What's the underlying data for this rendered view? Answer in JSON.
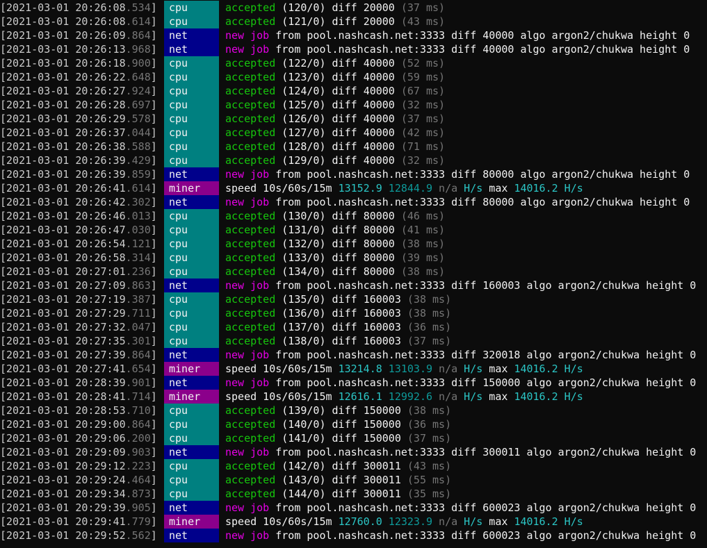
{
  "window": {
    "title": ""
  },
  "lines": [
    {
      "ts": "2021-03-01 20:26:08",
      "ms": ".534",
      "tag": "cpu",
      "kind": "accepted",
      "count": "(120/0)",
      "diff": "20000",
      "lat": "(37 ms)"
    },
    {
      "ts": "2021-03-01 20:26:08",
      "ms": ".614",
      "tag": "cpu",
      "kind": "accepted",
      "count": "(121/0)",
      "diff": "20000",
      "lat": "(43 ms)"
    },
    {
      "ts": "2021-03-01 20:26:09",
      "ms": ".864",
      "tag": "net",
      "kind": "job",
      "pool": "pool.nashcash.net:3333",
      "diff": "40000",
      "algo": "argon2/chukwa",
      "height": "0"
    },
    {
      "ts": "2021-03-01 20:26:13",
      "ms": ".968",
      "tag": "net",
      "kind": "job",
      "pool": "pool.nashcash.net:3333",
      "diff": "40000",
      "algo": "argon2/chukwa",
      "height": "0"
    },
    {
      "ts": "2021-03-01 20:26:18",
      "ms": ".900",
      "tag": "cpu",
      "kind": "accepted",
      "count": "(122/0)",
      "diff": "40000",
      "lat": "(52 ms)"
    },
    {
      "ts": "2021-03-01 20:26:22",
      "ms": ".648",
      "tag": "cpu",
      "kind": "accepted",
      "count": "(123/0)",
      "diff": "40000",
      "lat": "(59 ms)"
    },
    {
      "ts": "2021-03-01 20:26:27",
      "ms": ".924",
      "tag": "cpu",
      "kind": "accepted",
      "count": "(124/0)",
      "diff": "40000",
      "lat": "(67 ms)"
    },
    {
      "ts": "2021-03-01 20:26:28",
      "ms": ".697",
      "tag": "cpu",
      "kind": "accepted",
      "count": "(125/0)",
      "diff": "40000",
      "lat": "(32 ms)"
    },
    {
      "ts": "2021-03-01 20:26:29",
      "ms": ".578",
      "tag": "cpu",
      "kind": "accepted",
      "count": "(126/0)",
      "diff": "40000",
      "lat": "(37 ms)"
    },
    {
      "ts": "2021-03-01 20:26:37",
      "ms": ".044",
      "tag": "cpu",
      "kind": "accepted",
      "count": "(127/0)",
      "diff": "40000",
      "lat": "(42 ms)"
    },
    {
      "ts": "2021-03-01 20:26:38",
      "ms": ".588",
      "tag": "cpu",
      "kind": "accepted",
      "count": "(128/0)",
      "diff": "40000",
      "lat": "(71 ms)"
    },
    {
      "ts": "2021-03-01 20:26:39",
      "ms": ".429",
      "tag": "cpu",
      "kind": "accepted",
      "count": "(129/0)",
      "diff": "40000",
      "lat": "(32 ms)"
    },
    {
      "ts": "2021-03-01 20:26:39",
      "ms": ".859",
      "tag": "net",
      "kind": "job",
      "pool": "pool.nashcash.net:3333",
      "diff": "80000",
      "algo": "argon2/chukwa",
      "height": "0"
    },
    {
      "ts": "2021-03-01 20:26:41",
      "ms": ".614",
      "tag": "miner",
      "kind": "speed",
      "s10": "13152.9",
      "s60": "12844.9",
      "s15": "n/a",
      "max": "14016.2"
    },
    {
      "ts": "2021-03-01 20:26:42",
      "ms": ".302",
      "tag": "net",
      "kind": "job",
      "pool": "pool.nashcash.net:3333",
      "diff": "80000",
      "algo": "argon2/chukwa",
      "height": "0"
    },
    {
      "ts": "2021-03-01 20:26:46",
      "ms": ".013",
      "tag": "cpu",
      "kind": "accepted",
      "count": "(130/0)",
      "diff": "80000",
      "lat": "(46 ms)"
    },
    {
      "ts": "2021-03-01 20:26:47",
      "ms": ".030",
      "tag": "cpu",
      "kind": "accepted",
      "count": "(131/0)",
      "diff": "80000",
      "lat": "(41 ms)"
    },
    {
      "ts": "2021-03-01 20:26:54",
      "ms": ".121",
      "tag": "cpu",
      "kind": "accepted",
      "count": "(132/0)",
      "diff": "80000",
      "lat": "(38 ms)"
    },
    {
      "ts": "2021-03-01 20:26:58",
      "ms": ".314",
      "tag": "cpu",
      "kind": "accepted",
      "count": "(133/0)",
      "diff": "80000",
      "lat": "(39 ms)"
    },
    {
      "ts": "2021-03-01 20:27:01",
      "ms": ".236",
      "tag": "cpu",
      "kind": "accepted",
      "count": "(134/0)",
      "diff": "80000",
      "lat": "(38 ms)"
    },
    {
      "ts": "2021-03-01 20:27:09",
      "ms": ".863",
      "tag": "net",
      "kind": "job",
      "pool": "pool.nashcash.net:3333",
      "diff": "160003",
      "algo": "argon2/chukwa",
      "height": "0"
    },
    {
      "ts": "2021-03-01 20:27:19",
      "ms": ".387",
      "tag": "cpu",
      "kind": "accepted",
      "count": "(135/0)",
      "diff": "160003",
      "lat": "(38 ms)"
    },
    {
      "ts": "2021-03-01 20:27:29",
      "ms": ".711",
      "tag": "cpu",
      "kind": "accepted",
      "count": "(136/0)",
      "diff": "160003",
      "lat": "(38 ms)"
    },
    {
      "ts": "2021-03-01 20:27:32",
      "ms": ".047",
      "tag": "cpu",
      "kind": "accepted",
      "count": "(137/0)",
      "diff": "160003",
      "lat": "(36 ms)"
    },
    {
      "ts": "2021-03-01 20:27:35",
      "ms": ".301",
      "tag": "cpu",
      "kind": "accepted",
      "count": "(138/0)",
      "diff": "160003",
      "lat": "(37 ms)"
    },
    {
      "ts": "2021-03-01 20:27:39",
      "ms": ".864",
      "tag": "net",
      "kind": "job",
      "pool": "pool.nashcash.net:3333",
      "diff": "320018",
      "algo": "argon2/chukwa",
      "height": "0"
    },
    {
      "ts": "2021-03-01 20:27:41",
      "ms": ".654",
      "tag": "miner",
      "kind": "speed",
      "s10": "13214.8",
      "s60": "13103.9",
      "s15": "n/a",
      "max": "14016.2"
    },
    {
      "ts": "2021-03-01 20:28:39",
      "ms": ".901",
      "tag": "net",
      "kind": "job",
      "pool": "pool.nashcash.net:3333",
      "diff": "150000",
      "algo": "argon2/chukwa",
      "height": "0"
    },
    {
      "ts": "2021-03-01 20:28:41",
      "ms": ".714",
      "tag": "miner",
      "kind": "speed",
      "s10": "12616.1",
      "s60": "12992.6",
      "s15": "n/a",
      "max": "14016.2"
    },
    {
      "ts": "2021-03-01 20:28:53",
      "ms": ".710",
      "tag": "cpu",
      "kind": "accepted",
      "count": "(139/0)",
      "diff": "150000",
      "lat": "(38 ms)"
    },
    {
      "ts": "2021-03-01 20:29:00",
      "ms": ".864",
      "tag": "cpu",
      "kind": "accepted",
      "count": "(140/0)",
      "diff": "150000",
      "lat": "(36 ms)"
    },
    {
      "ts": "2021-03-01 20:29:06",
      "ms": ".200",
      "tag": "cpu",
      "kind": "accepted",
      "count": "(141/0)",
      "diff": "150000",
      "lat": "(37 ms)"
    },
    {
      "ts": "2021-03-01 20:29:09",
      "ms": ".903",
      "tag": "net",
      "kind": "job",
      "pool": "pool.nashcash.net:3333",
      "diff": "300011",
      "algo": "argon2/chukwa",
      "height": "0"
    },
    {
      "ts": "2021-03-01 20:29:12",
      "ms": ".223",
      "tag": "cpu",
      "kind": "accepted",
      "count": "(142/0)",
      "diff": "300011",
      "lat": "(43 ms)"
    },
    {
      "ts": "2021-03-01 20:29:24",
      "ms": ".464",
      "tag": "cpu",
      "kind": "accepted",
      "count": "(143/0)",
      "diff": "300011",
      "lat": "(55 ms)"
    },
    {
      "ts": "2021-03-01 20:29:34",
      "ms": ".873",
      "tag": "cpu",
      "kind": "accepted",
      "count": "(144/0)",
      "diff": "300011",
      "lat": "(35 ms)"
    },
    {
      "ts": "2021-03-01 20:29:39",
      "ms": ".905",
      "tag": "net",
      "kind": "job",
      "pool": "pool.nashcash.net:3333",
      "diff": "600023",
      "algo": "argon2/chukwa",
      "height": "0"
    },
    {
      "ts": "2021-03-01 20:29:41",
      "ms": ".779",
      "tag": "miner",
      "kind": "speed",
      "s10": "12760.0",
      "s60": "12323.9",
      "s15": "n/a",
      "max": "14016.2"
    },
    {
      "ts": "2021-03-01 20:29:52",
      "ms": ".562",
      "tag": "net",
      "kind": "job",
      "pool": "pool.nashcash.net:3333",
      "diff": "600023",
      "algo": "argon2/chukwa",
      "height": "0"
    }
  ],
  "colors": {
    "background": "#0c0c0c",
    "cpu_tag": "#008080",
    "net_tag": "#00008b",
    "miner_tag": "#8b008b",
    "accepted": "#16c60c",
    "new_job": "#e600e6",
    "hashrate": "#2bc6c6"
  }
}
